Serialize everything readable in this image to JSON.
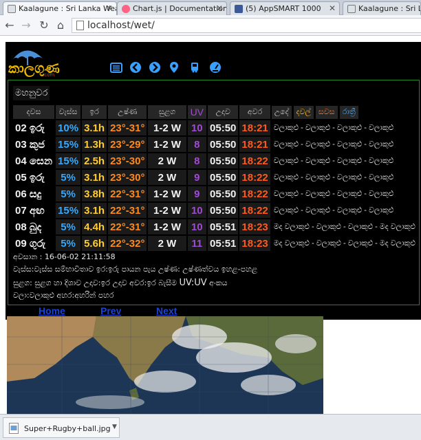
{
  "browser": {
    "tabs": [
      {
        "title": "Kaalagune : Sri Lanka Wea",
        "active": true
      },
      {
        "title": "Chart.js | Documentation",
        "active": false
      },
      {
        "title": "(5) AppSMART 1000",
        "active": false
      },
      {
        "title": "Kaalagune : Sri Lanka",
        "active": false
      }
    ],
    "url": "localhost/wet/",
    "download": {
      "filename": "Super+Rugby+ball.jpg"
    }
  },
  "site": {
    "logo_text": "කාලගුණ",
    "logo_sub": ".com",
    "nav_icons": [
      "list-icon",
      "prev-arrow-icon",
      "next-arrow-icon",
      "location-pin-icon",
      "bus-icon",
      "speedometer-icon"
    ],
    "district": "මහනුවර",
    "headers": {
      "day": "දවස",
      "rain": "වැස්ස",
      "sun": "ඉර",
      "temp": "උෂ්ණ",
      "wind": "සුළග",
      "uv": "UV",
      "sunrise": "උදාව",
      "sunset": "අවර",
      "morning": "උදේ",
      "daytime": "දවල්",
      "evening": "සවස",
      "night": "රාත්‍රී"
    },
    "forecast": [
      {
        "day": "02 ඉරු",
        "rain": "10%",
        "sun": "3.1h",
        "temp": "23°-31°",
        "wind": "1-2 W",
        "uv": "10",
        "sunrise": "05:50",
        "sunset": "18:21",
        "desc": "වලාකුළු - වලාකුළු - වලාකුළු - වලාකුළු"
      },
      {
        "day": "03 කුජ",
        "rain": "15%",
        "sun": "1.3h",
        "temp": "23°-29°",
        "wind": "1-2 W",
        "uv": "8",
        "sunrise": "05:50",
        "sunset": "18:21",
        "desc": "වලාකුළු - වලාකුළු - වලාකුළු - වලාකුළු"
      },
      {
        "day": "04 සෙන",
        "rain": "15%",
        "sun": "2.5h",
        "temp": "23°-30°",
        "wind": "2 W",
        "uv": "8",
        "sunrise": "05:50",
        "sunset": "18:22",
        "desc": "වලාකුළු - වලාකුළු - වලාකුළු - වලාකුළු"
      },
      {
        "day": "05 ඉරු",
        "rain": "5%",
        "sun": "3.1h",
        "temp": "23°-30°",
        "wind": "2 W",
        "uv": "9",
        "sunrise": "05:50",
        "sunset": "18:22",
        "desc": "වලාකුළු - වලාකුළු - වලාකුළු - වලාකුළු"
      },
      {
        "day": "06 සදු",
        "rain": "5%",
        "sun": "3.8h",
        "temp": "22°-31°",
        "wind": "1-2 W",
        "uv": "9",
        "sunrise": "05:50",
        "sunset": "18:22",
        "desc": "වලාකුළු - වලාකුළු - වලාකුළු - වලාකුළු"
      },
      {
        "day": "07 අඟ",
        "rain": "15%",
        "sun": "3.1h",
        "temp": "22°-31°",
        "wind": "1-2 W",
        "uv": "10",
        "sunrise": "05:50",
        "sunset": "18:22",
        "desc": "වලාකුළු - වලාකුළු - වලාකුළු - වලාකුළු"
      },
      {
        "day": "08 බුද",
        "rain": "5%",
        "sun": "4.4h",
        "temp": "22°-31°",
        "wind": "1-2 W",
        "uv": "10",
        "sunrise": "05:51",
        "sunset": "18:23",
        "desc": "මද වලාකුළු - වලාකුළු - වලාකුළු - මද වලාකුළු"
      },
      {
        "day": "09 ගුරු",
        "rain": "5%",
        "sun": "5.6h",
        "temp": "22°-32°",
        "wind": "2 W",
        "uv": "11",
        "sunrise": "05:51",
        "sunset": "18:23",
        "desc": "මද වලාකුළු - වලාකුළු - වලාකුළු - මද වලාකුළු"
      }
    ],
    "updated": "අවසාන : 16-06-02 21:11:58",
    "legend_line1": "වැස්ස:වැස්ස සම්භාවිතාව ඉර:ඉරු පායන පැය උෂ්ණ: උෂ්ණත්වය ඉහළ-පහළ",
    "legend_line2_prefix": "සුළග: සුළග හා දිශාව උදාව:ඉර උදාව අවර:ඉර බැසීම",
    "legend_line2_uv": "UV:UV",
    "legend_line2_suffix": "අංකය",
    "legend_line3": "වලා:වලාකුළු අහර:අහරින් පහර",
    "pager": {
      "home": "Home",
      "prev": "Prev",
      "next": "Next"
    }
  },
  "colors": {
    "rain": "#33aaff",
    "sun": "#ffcc33",
    "temp": "#ff8a1a",
    "uv": "#a24ad8",
    "sunset": "#ff5a1e",
    "border": "#1e8a1e",
    "link": "#1c44d4"
  }
}
